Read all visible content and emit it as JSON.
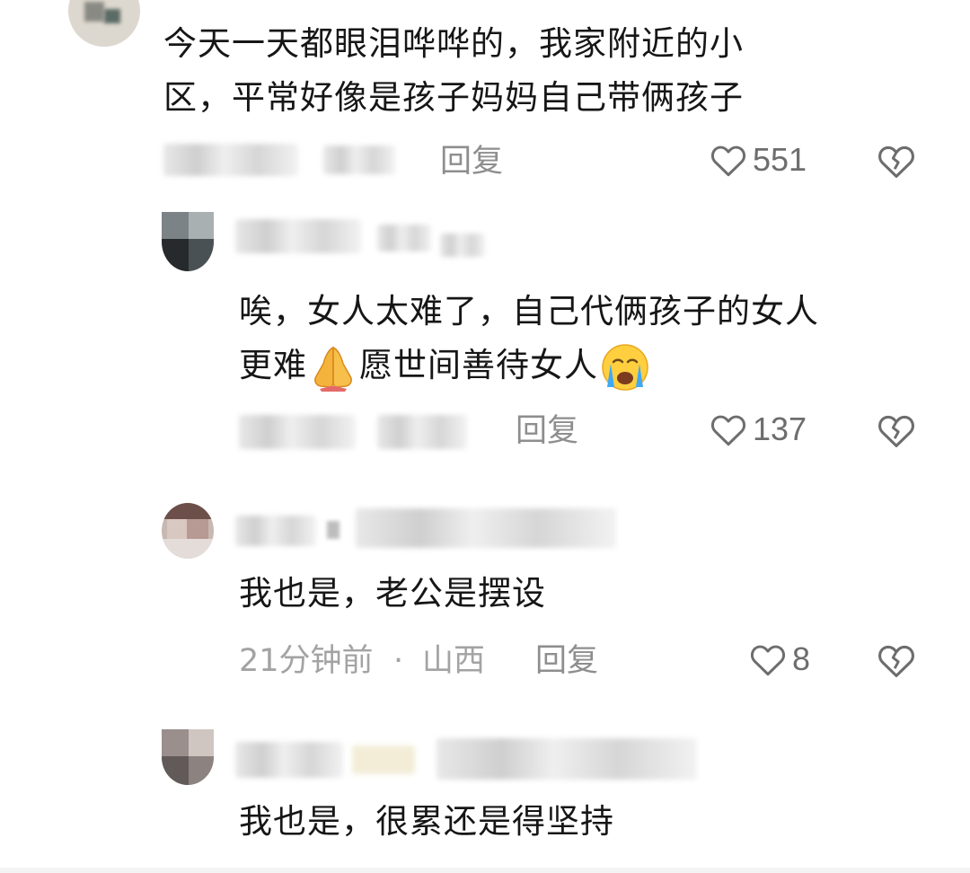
{
  "comments": [
    {
      "text_line1": "今天一天都眼泪哗哗的，我家附近的小",
      "text_line2": "区，平常好像是孩子妈妈自己带俩孩子",
      "reply_label": "回复",
      "likes": "551"
    },
    {
      "text_line1": "唉，女人太难了，自己代俩孩子的女人",
      "text_line2_a": "更难",
      "text_line2_b": "愿世间善待女人",
      "emoji1": "folded-hands-emoji",
      "emoji2": "crying-face-emoji",
      "reply_label": "回复",
      "likes": "137"
    },
    {
      "text_line1": "我也是，老公是摆设",
      "time": "21分钟前",
      "separator": "·",
      "location": "山西",
      "reply_label": "回复",
      "likes": "8"
    },
    {
      "text_line1": "我也是，很累还是得坚持"
    }
  ],
  "icons": {
    "like": "heart-outline-icon",
    "dislike": "broken-heart-icon"
  },
  "colors": {
    "text": "#161616",
    "meta": "#a3a3a3",
    "icon": "#6d6d6d"
  }
}
